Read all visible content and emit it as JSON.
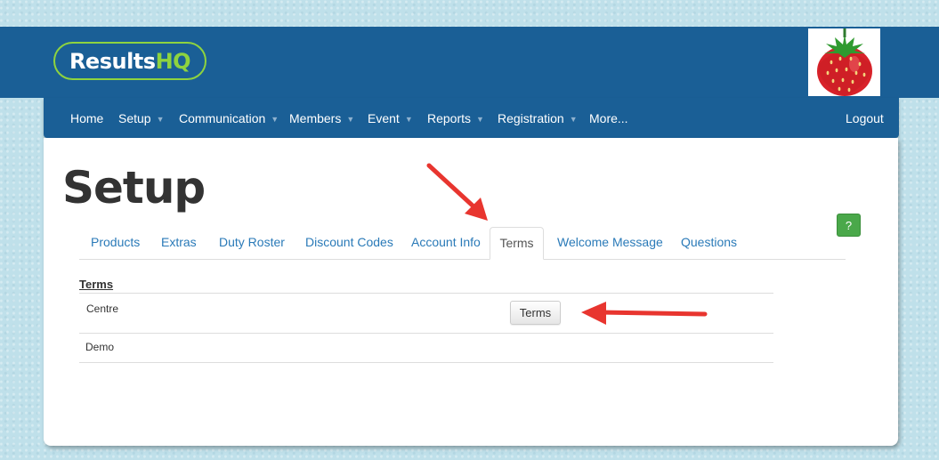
{
  "header": {
    "logo": {
      "part1": "Results",
      "part2": "HQ"
    },
    "avatar": "strawberry-icon"
  },
  "nav": {
    "items": [
      {
        "label": "Home",
        "dropdown": false
      },
      {
        "label": "Setup",
        "dropdown": true
      },
      {
        "label": "Communication",
        "dropdown": true
      },
      {
        "label": "Members",
        "dropdown": true
      },
      {
        "label": "Event",
        "dropdown": true
      },
      {
        "label": "Reports",
        "dropdown": true
      },
      {
        "label": "Registration",
        "dropdown": true
      },
      {
        "label": "More...",
        "dropdown": false
      }
    ],
    "logout": "Logout"
  },
  "page": {
    "title": "Setup",
    "help": "?"
  },
  "tabs": [
    {
      "label": "Products",
      "active": false
    },
    {
      "label": "Extras",
      "active": false
    },
    {
      "label": "Duty Roster",
      "active": false
    },
    {
      "label": "Discount Codes",
      "active": false
    },
    {
      "label": "Account Info",
      "active": false
    },
    {
      "label": "Terms",
      "active": true
    },
    {
      "label": "Welcome Message",
      "active": false
    },
    {
      "label": "Questions",
      "active": false
    }
  ],
  "terms_section": {
    "title": "Terms",
    "rows": [
      {
        "name": "Centre",
        "button": "Terms"
      },
      {
        "name": "Demo"
      }
    ]
  },
  "colors": {
    "brand_blue": "#1a5f96",
    "logo_green": "#8ed33f",
    "link_blue": "#2a7ab8",
    "help_green": "#4aa84a",
    "annotation_red": "#e8352f"
  }
}
